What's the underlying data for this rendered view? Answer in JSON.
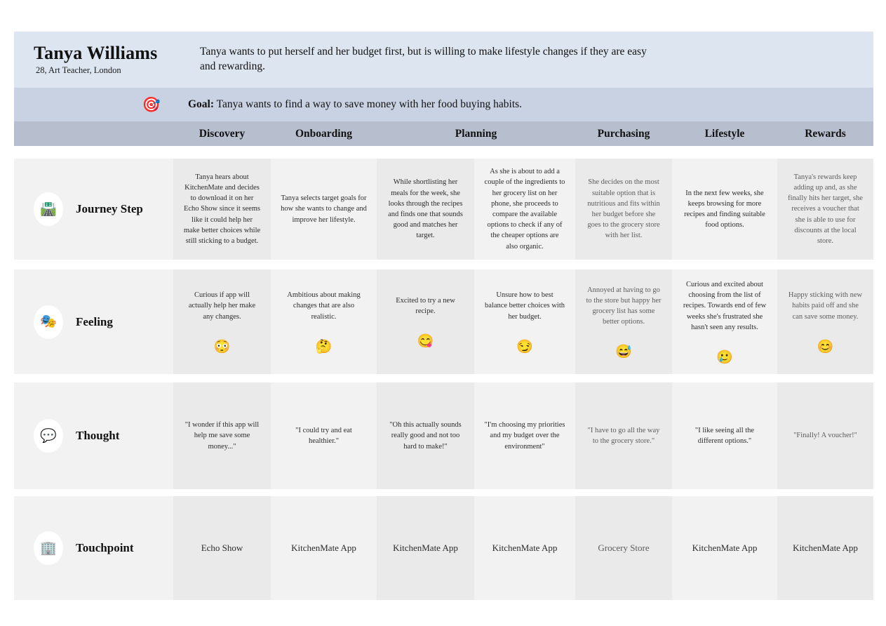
{
  "persona": {
    "name": "Tanya Williams",
    "meta": "28, Art Teacher, London",
    "description": "Tanya wants to put herself and her budget first, but is willing to make lifestyle changes if they are easy and rewarding."
  },
  "goal": {
    "icon": "🎯",
    "label": "Goal:",
    "text": "Tanya wants to find a way to save money with her food buying habits."
  },
  "stages": [
    "Discovery",
    "Onboarding",
    "Planning",
    "Purchasing",
    "Lifestyle",
    "Rewards"
  ],
  "rows": [
    {
      "label": "Journey Step",
      "icon": "🛣️",
      "icon_name": "route-icon",
      "cells": [
        "Tanya hears about KitchenMate and decides to download it on her Echo Show since it seems like it could help her make better choices while still sticking to a budget.",
        "Tanya selects target goals for how she wants to change and improve her lifestyle.",
        "While shortlisting her meals for the week, she looks through the recipes and finds one that sounds good and matches her target.",
        "As she is about to add a couple of the ingredients to her grocery list on her phone, she proceeds to compare the available options to check if any of the cheaper options are also organic.",
        "She decides on the most suitable option that is nutritious and fits within her budget before she goes to the grocery store with her list.",
        "In the next few weeks, she keeps browsing for more recipes and finding suitable food options.",
        "Tanya's rewards keep adding up and, as she finally hits her target, she receives a voucher that she is able to use for discounts at the local store."
      ]
    },
    {
      "label": "Feeling",
      "icon": "🎭",
      "icon_name": "theater-masks-icon",
      "cells": [
        "Curious if app will actually help her make any changes.",
        "Ambitious about making changes that are also realistic.",
        "Excited to try a new recipe.",
        "Unsure how to best balance better choices with her budget.",
        "Annoyed at having to go to the store but happy her grocery list has some better options.",
        "Curious and excited about choosing from the list of recipes. Towards end of few weeks she's frustrated she hasn't seen any results.",
        "Happy sticking with new habits paid off and she can save some money."
      ],
      "emojis": [
        "😳",
        "🤔",
        "😋",
        "😏",
        "😅",
        "🥲",
        "😊"
      ]
    },
    {
      "label": "Thought",
      "icon": "💬",
      "icon_name": "speech-balloon-icon",
      "cells": [
        "\"I wonder if this app will help me save some money...\"",
        "\"I could try and eat healthier.\"",
        "\"Oh this actually sounds really good and not too hard to make!\"",
        "\"I'm choosing my priorities and my budget over the environment\"",
        "\"I have to go all the way to the grocery store.\"",
        "\"I like seeing all the different options.\"",
        "\"Finally! A voucher!\""
      ]
    },
    {
      "label": "Touchpoint",
      "icon": "🏢",
      "icon_name": "office-building-icon",
      "cells": [
        "Echo Show",
        "KitchenMate App",
        "KitchenMate App",
        "KitchenMate App",
        "Grocery Store",
        "KitchenMate App",
        "KitchenMate App"
      ]
    }
  ],
  "colors": {
    "persona_band": "#dde5f0",
    "goal_band": "#c9d2e3",
    "stage_band": "#b7bfce",
    "cell_light": "#f2f2f2",
    "cell_alt": "#eaeaea"
  }
}
